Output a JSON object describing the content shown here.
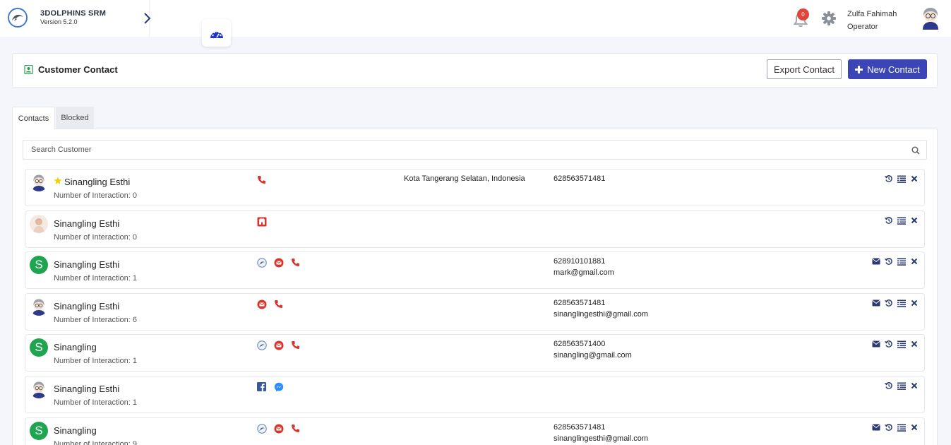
{
  "app": {
    "title": "3DOLPHINS SRM",
    "version": "Version 5.2.0"
  },
  "topbar": {
    "notification_count": "0",
    "user_name": "Zulfa Fahimah",
    "user_role": "Operator"
  },
  "header": {
    "title": "Customer Contact",
    "export_label": "Export Contact",
    "new_label": "New Contact"
  },
  "tabs": [
    {
      "label": "Contacts"
    },
    {
      "label": "Blocked"
    }
  ],
  "search": {
    "placeholder": "Search Customer"
  },
  "colors": {
    "accent": "#3b45b5",
    "avatar_green": "#1fa450",
    "channel_red": "#d9342b",
    "badge_red": "#e0453a"
  },
  "contacts": [
    {
      "name": "Sinangling Esthi",
      "starred": true,
      "avatar": "operator-avatar",
      "interactions": "Number of Interaction: 0",
      "channels": [
        "phone-icon"
      ],
      "location": "Kota Tangerang Selatan, Indonesia",
      "phone": "628563571481",
      "email": "",
      "actions": [
        "history-icon",
        "list-icon",
        "close-icon"
      ]
    },
    {
      "name": "Sinangling Esthi",
      "starred": false,
      "avatar": "photo-avatar",
      "interactions": "Number of Interaction: 0",
      "channels": [
        "store-icon"
      ],
      "location": "",
      "phone": "",
      "email": "",
      "actions": [
        "history-icon",
        "list-icon",
        "close-icon"
      ]
    },
    {
      "name": "Sinangling Esthi",
      "starred": false,
      "avatar": "S",
      "interactions": "Number of Interaction: 1",
      "channels": [
        "bot-icon",
        "email-icon",
        "phone-icon"
      ],
      "location": "",
      "phone": "628910101881",
      "email": "mark@gmail.com",
      "actions": [
        "mail-icon",
        "history-icon",
        "list-icon",
        "close-icon"
      ]
    },
    {
      "name": "Sinangling Esthi",
      "starred": false,
      "avatar": "operator-avatar",
      "interactions": "Number of Interaction: 6",
      "channels": [
        "email-icon",
        "phone-icon"
      ],
      "location": "",
      "phone": "628563571481",
      "email": "sinanglingesthi@gmail.com",
      "actions": [
        "mail-icon",
        "history-icon",
        "list-icon",
        "close-icon"
      ]
    },
    {
      "name": "Sinangling",
      "starred": false,
      "avatar": "S",
      "interactions": "Number of Interaction: 1",
      "channels": [
        "bot-icon",
        "email-icon",
        "phone-icon"
      ],
      "location": "",
      "phone": "628563571400",
      "email": "sinangling@gmail.com",
      "actions": [
        "mail-icon",
        "history-icon",
        "list-icon",
        "close-icon"
      ]
    },
    {
      "name": "Sinangling Esthi",
      "starred": false,
      "avatar": "operator-avatar",
      "interactions": "Number of Interaction: 1",
      "channels": [
        "facebook-icon",
        "messenger-icon"
      ],
      "location": "",
      "phone": "",
      "email": "",
      "actions": [
        "history-icon",
        "list-icon",
        "close-icon"
      ]
    },
    {
      "name": "Sinangling",
      "starred": false,
      "avatar": "S",
      "interactions": "Number of Interaction: 9",
      "channels": [
        "bot-icon",
        "email-icon",
        "phone-icon"
      ],
      "location": "",
      "phone": "628563571481",
      "email": "sinanglingesthi@gmail.com",
      "actions": [
        "mail-icon",
        "history-icon",
        "list-icon",
        "close-icon"
      ]
    }
  ]
}
